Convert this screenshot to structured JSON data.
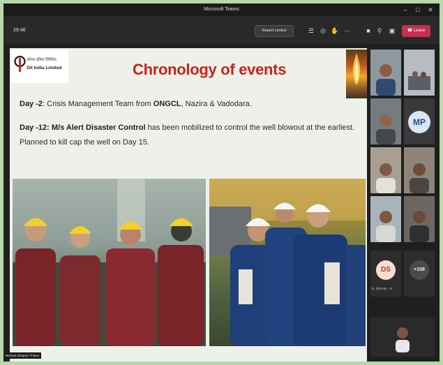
{
  "window": {
    "title": "Microsoft Teams"
  },
  "toolbar": {
    "timer": "29:46",
    "report_button": "Report control",
    "leave_button": "Leave"
  },
  "slide": {
    "logo_hindi": "ऑयल इंडिया लिमिटेड",
    "logo_name": "Oil India Limited",
    "title": "Chronology of events",
    "line1_day": "Day -2",
    "line1_text": ": Crisis Management Team from ",
    "line1_org": "ONGCL",
    "line1_tail": ", Nazira & Vadodara.",
    "line2_day": "Day -12: M/s Alert Disaster Control",
    "line2_text": " has been mobilized to control the well blowout at the earliest.",
    "line3_text": "Planned to kill cap the well on Day 15."
  },
  "presenter": {
    "name": "Nishant Dhapani Thakur"
  },
  "participants": {
    "mp_initials": "MP",
    "ds_initials": "DS",
    "ds_name": "D. GOLAK... 8",
    "overflow_count": "+108"
  },
  "colors": {
    "leave": "#c4314b",
    "title_red": "#c8231c",
    "mp_avatar": "#d8e7f7",
    "ds_avatar": "#f7dcd2"
  }
}
